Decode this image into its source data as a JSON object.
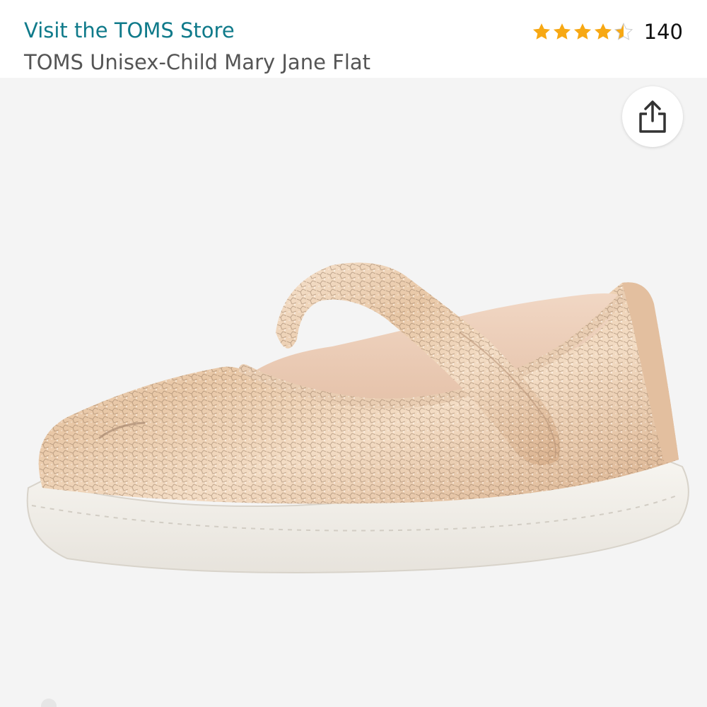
{
  "header": {
    "store_link": "Visit the TOMS Store",
    "product_title": "TOMS Unisex-Child Mary Jane Flat",
    "rating_value": 4.5,
    "rating_count": "140",
    "star_color": "#f7a813"
  },
  "gallery": {
    "share_icon": "share-icon",
    "background_color": "#f4f4f4",
    "image_description_icon": "product-image"
  }
}
